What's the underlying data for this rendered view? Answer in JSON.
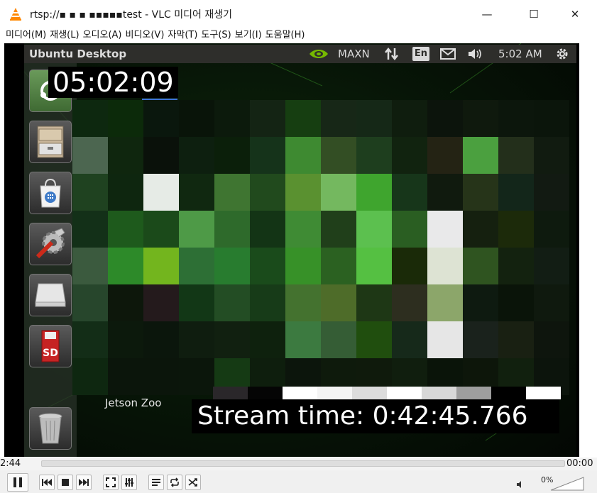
{
  "window": {
    "title": "rtsp://▪︎ ▪︎ ▪︎ ▪︎▪︎▪︎▪︎▪︎test - VLC 미디어 재생기",
    "minimize": "—",
    "maximize": "☐",
    "close": "✕"
  },
  "menu": [
    "미디어(M)",
    "재생(L)",
    "오디오(A)",
    "비디오(V)",
    "자막(T)",
    "도구(S)",
    "보기(I)",
    "도움말(H)"
  ],
  "video": {
    "ubuntu_topbar": {
      "title": "Ubuntu Desktop",
      "power_mode": "MAXN",
      "language": "En",
      "time": "5:02 AM"
    },
    "launcher_icons": [
      "ubuntu-dash-icon",
      "file-cabinet-icon",
      "software-center-icon",
      "system-settings-icon",
      "drive-icon",
      "sd-card-icon",
      "trash-icon"
    ],
    "sd_label": "SD",
    "clock_overlay": "05:02:09",
    "wallpaper_label": "Jetson Zoo",
    "stream_time": "Stream time: 0:42:45.766",
    "mosaic_rows": [
      [
        "#0d280f",
        "#0c2a0a",
        "#0a170d",
        "#091409",
        "#0c1a0c",
        "#142414",
        "#163e11",
        "#172717",
        "#152817",
        "#0f1d0e",
        "#0c140c",
        "#0f190d",
        "#0c160c",
        "#0b150b"
      ],
      [
        "#4c6650",
        "#0f260e",
        "#0a110a",
        "#0d1f0f",
        "#0b1f0a",
        "#15331a",
        "#3e8a31",
        "#334e24",
        "#1e3e1e",
        "#11230f",
        "#242314",
        "#4ba03f",
        "#232f1b",
        "#111b10"
      ],
      [
        "#1f4220",
        "#0e260f",
        "#e6ebe6",
        "#102810",
        "#3f7531",
        "#214a1d",
        "#5a9130",
        "#74b85f",
        "#3fa52e",
        "#17361a",
        "#101a0e",
        "#263419",
        "#13261a",
        "#121a12"
      ],
      [
        "#133018",
        "#1e5a1c",
        "#1b4a1a",
        "#4e9a47",
        "#2e6a2b",
        "#133415",
        "#3f8b34",
        "#203f1a",
        "#5cc04f",
        "#2a5e22",
        "#e9e9ea",
        "#15200f",
        "#1c2a0a",
        "#0e1a0e"
      ],
      [
        "#3b5a3e",
        "#2d8a29",
        "#73b51e",
        "#2d6f35",
        "#287c2f",
        "#1a4b1b",
        "#379128",
        "#2b6121",
        "#55c042",
        "#1a2a08",
        "#dde3d3",
        "#2f5420",
        "#13220f",
        "#121d14"
      ],
      [
        "#27462c",
        "#0d170b",
        "#241a1c",
        "#123716",
        "#234d24",
        "#173b18",
        "#44722f",
        "#4e6c29",
        "#1e3715",
        "#2d2e1f",
        "#8ca66a",
        "#0e1a10",
        "#0a1409",
        "#0f190e"
      ],
      [
        "#132d17",
        "#0c190c",
        "#0b160c",
        "#0f1d0f",
        "#112010",
        "#0e210d",
        "#3c7a40",
        "#355d35",
        "#204e0e",
        "#16291a",
        "#e6e6e6",
        "#1a221c",
        "#192012",
        "#0e150d"
      ],
      [
        "#0e2710",
        "#0b150b",
        "#0b150b",
        "#0b160b",
        "#153a14",
        "#0e1e0d",
        "#0c150c",
        "#0e1a0c",
        "#0f1a0c",
        "#101e0e",
        "#0a1409",
        "#0d160a",
        "#11200e",
        "#0c140c"
      ]
    ],
    "bottom_strip": [
      "#2a272a",
      "#050505",
      "#ffffff",
      "#f4f4f4",
      "#dcdcdc",
      "#ffffff",
      "#d8d8d8",
      "#9e9e9e",
      "#000000",
      "#ffffff"
    ]
  },
  "seek": {
    "elapsed": "2:44",
    "total": "00:00"
  },
  "controls": {
    "volume_percent": "0%",
    "icons": [
      "pause-icon",
      "prev-icon",
      "stop-icon",
      "next-icon",
      "fullscreen-icon",
      "extended-settings-icon",
      "playlist-icon",
      "loop-icon",
      "shuffle-icon",
      "speaker-icon"
    ]
  }
}
